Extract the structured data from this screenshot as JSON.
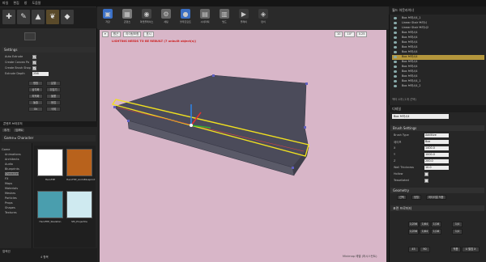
{
  "menu": {
    "items": [
      "파일",
      "편집",
      "창",
      "도움말"
    ]
  },
  "modes": {
    "active_index": 3
  },
  "geometry_settings": {
    "header": "Settings",
    "rows": [
      {
        "label": "Auto Extrude",
        "checked": true
      },
      {
        "label": "Create Convex Po",
        "checked": true
      },
      {
        "label": "Create Brush Shap",
        "checked": true
      },
      {
        "label": "Extrude Depth",
        "value": "256"
      }
    ],
    "buttons": [
      "병합",
      "분할",
      "삼각화",
      "뒤집기",
      "최적화",
      "볼륨",
      "돌출",
      "용접",
      "Ok",
      "삭제"
    ]
  },
  "content_browser": {
    "tab": "콘텐츠 브라우저",
    "toolbar": [
      "추가",
      "임포트"
    ],
    "path": "Game ▸ Character",
    "tree": [
      "Game",
      "Animations",
      "Architects",
      "Audio",
      "Blueprints",
      "Character",
      "FX",
      "Maps",
      "Materials",
      "Meshes",
      "Particles",
      "Props",
      "Shapes",
      "Textures"
    ],
    "selected_folder": "Character",
    "assets": [
      {
        "name": "HeroFPP",
        "color": "#ffffff"
      },
      {
        "name": "HeroFPP_AnimBlueprint",
        "color": "#b8621c"
      },
      {
        "name": "HeroFPP_Skeleton",
        "color": "#4a9eae"
      },
      {
        "name": "SM_Projectile",
        "color": "#cfeaf0"
      }
    ],
    "footer": "4 항목",
    "collection": "컬렉션"
  },
  "toolbar": {
    "items": [
      {
        "label": "저장",
        "icon": "save-icon",
        "color": "#3a70c8"
      },
      {
        "label": "콘텐츠",
        "icon": "content-icon",
        "color": "#7a7a7a"
      },
      {
        "label": "마켓플레이스",
        "icon": "marketplace-icon",
        "color": "#444"
      },
      {
        "label": "세팅",
        "icon": "settings-icon",
        "color": "#666"
      },
      {
        "label": "블루프린트",
        "icon": "blueprint-icon",
        "color": "#3a6ec2"
      },
      {
        "label": "시네마틱",
        "icon": "cinematics-icon",
        "color": "#666"
      },
      {
        "label": "빌드",
        "icon": "build-icon",
        "color": "#666"
      },
      {
        "label": "플레이",
        "icon": "play-icon",
        "color": "#3a3a3a"
      },
      {
        "label": "런치",
        "icon": "launch-icon",
        "color": "#3a3a3a"
      }
    ]
  },
  "viewport": {
    "chips": [
      "원근",
      "라이팅포함",
      "표시"
    ],
    "snap": [
      "10",
      "10°",
      "0.25"
    ],
    "warning": "LIGHTING NEEDS TO BE REBUILT (7 unbuilt object(s))",
    "footer": "Minimap 레벨 (퍼시스턴트)",
    "bg_color": "#d8b6c8"
  },
  "outliner": {
    "header": "월드 아웃라이너",
    "rows": [
      "Box 브러시4_1",
      "Linear Stair 브러시",
      "Linear Stair 브러시2",
      "Box 브러시4",
      "Box 브러시4",
      "Box 브러시4",
      "Box 브러시4",
      "Box 브러시4",
      "Box 브러시4",
      "Box 브러시4",
      "Box 브러시4",
      "Box 브러시4",
      "Box 브러시4",
      "Box 브러시4_1",
      "Box 브러시4_2"
    ],
    "selected_index": 8,
    "footer": "액터 4개 (1개 선택)"
  },
  "details": {
    "header": "디테일",
    "name_value": "Box 브러시4",
    "brush_header": "Brush Settings",
    "rows": [
      {
        "label": "Brush Type",
        "value": "Additive"
      },
      {
        "label": "셰이프",
        "value": "Box"
      },
      {
        "label": "X",
        "value": "1400.0"
      },
      {
        "label": "Y",
        "value": "1000.0"
      },
      {
        "label": "Z",
        "value": "200.0"
      },
      {
        "label": "Wall Thickness",
        "value": "10.0"
      },
      {
        "label": "Hollow",
        "value": ""
      },
      {
        "label": "Tessellated",
        "value": ""
      }
    ],
    "geometry_header": "Geometry",
    "geometry_buttons": [
      "선택",
      "정렬",
      "머티리얼 적용"
    ],
    "uv_header": "표면 프로퍼티",
    "uv_cells": [
      "1/256",
      "1/64",
      "1/16",
      "1/4",
      "1/256",
      "1/64",
      "1/16",
      "1/4"
    ],
    "bottom": [
      "45",
      "90",
      "적용",
      "U 펼침 X"
    ]
  }
}
